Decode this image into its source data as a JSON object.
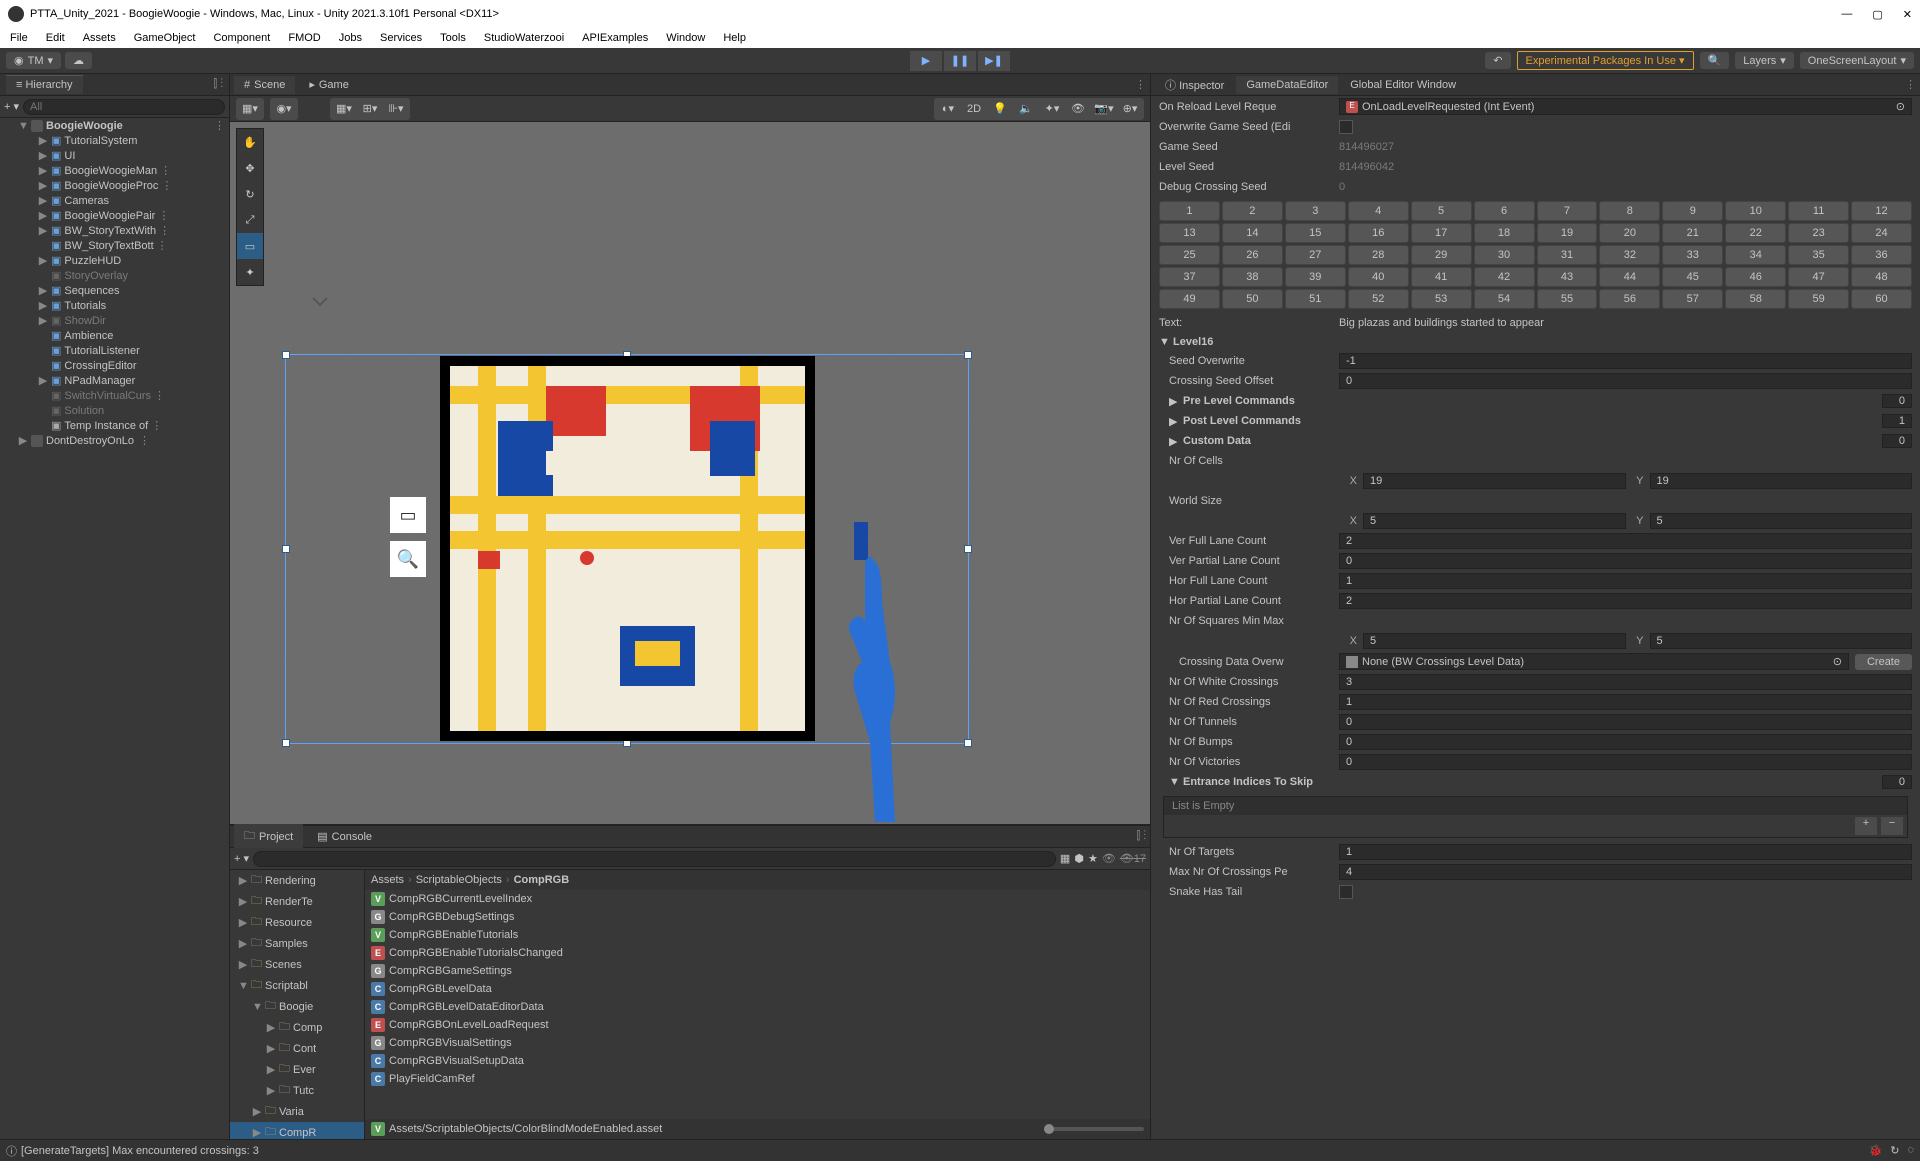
{
  "window": {
    "title": "PTTA_Unity_2021 - BoogieWoogie - Windows, Mac, Linux - Unity 2021.3.10f1 Personal <DX11>",
    "minimize": "—",
    "maximize": "▢",
    "close": "✕"
  },
  "menubar": [
    "File",
    "Edit",
    "Assets",
    "GameObject",
    "Component",
    "FMOD",
    "Jobs",
    "Services",
    "Tools",
    "StudioWaterzooi",
    "APIExamples",
    "Window",
    "Help"
  ],
  "toolbar": {
    "account": "TM",
    "experimental": "Experimental Packages In Use",
    "layers": "Layers",
    "layout": "OneScreenLayout"
  },
  "hierarchy": {
    "tab": "Hierarchy",
    "search_placeholder": "All",
    "scene": "BoogieWoogie",
    "items": [
      {
        "name": "TutorialSystem",
        "blue": true,
        "arrow": true
      },
      {
        "name": "UI",
        "blue": true,
        "arrow": true
      },
      {
        "name": "BoogieWoogieMan",
        "blue": true,
        "arrow": true,
        "trunc": true
      },
      {
        "name": "BoogieWoogieProc",
        "blue": true,
        "arrow": true,
        "trunc": true
      },
      {
        "name": "Cameras",
        "blue": true,
        "arrow": true
      },
      {
        "name": "BoogieWoogiePair",
        "blue": true,
        "arrow": true,
        "trunc": true
      },
      {
        "name": "BW_StoryTextWith",
        "blue": true,
        "arrow": true,
        "trunc": true
      },
      {
        "name": "BW_StoryTextBott",
        "blue": true,
        "trunc": true
      },
      {
        "name": "PuzzleHUD",
        "blue": true,
        "arrow": true
      },
      {
        "name": "StoryOverlay",
        "dim": true
      },
      {
        "name": "Sequences",
        "blue": true,
        "arrow": true
      },
      {
        "name": "Tutorials",
        "blue": true,
        "arrow": true
      },
      {
        "name": "ShowDir",
        "dim": true,
        "arrow": true
      },
      {
        "name": "Ambience",
        "blue": true
      },
      {
        "name": "TutorialListener",
        "blue": true
      },
      {
        "name": "CrossingEditor",
        "blue": true
      },
      {
        "name": "NPadManager",
        "blue": true,
        "arrow": true
      },
      {
        "name": "SwitchVirtualCurs",
        "dim": true,
        "trunc": true
      },
      {
        "name": "Solution",
        "dim": true
      },
      {
        "name": "Temp Instance of",
        "gray": true,
        "trunc": true
      }
    ],
    "dont_destroy": "DontDestroyOnLo"
  },
  "scene": {
    "tabs": [
      {
        "label": "Scene",
        "icon": "#"
      },
      {
        "label": "Game",
        "icon": "▶"
      }
    ],
    "btn_2d": "2D"
  },
  "project": {
    "tabs": [
      "Project",
      "Console"
    ],
    "hidden_count": "17",
    "folders": [
      {
        "name": "Rendering",
        "trunc": true
      },
      {
        "name": "RenderTe",
        "trunc": true
      },
      {
        "name": "Resource",
        "trunc": true
      },
      {
        "name": "Samples"
      },
      {
        "name": "Scenes"
      },
      {
        "name": "Scriptabl",
        "trunc": true,
        "open": true
      },
      {
        "name": "Boogie",
        "trunc": true,
        "indent": 1,
        "open": true
      },
      {
        "name": "Comp",
        "trunc": true,
        "indent": 2
      },
      {
        "name": "Cont",
        "trunc": true,
        "indent": 2
      },
      {
        "name": "Ever",
        "trunc": true,
        "indent": 2
      },
      {
        "name": "Tutc",
        "trunc": true,
        "indent": 2
      },
      {
        "name": "Varia",
        "trunc": true,
        "indent": 1
      },
      {
        "name": "CompR",
        "trunc": true,
        "indent": 1,
        "sel": true
      }
    ],
    "breadcrumb": [
      "Assets",
      "ScriptableObjects",
      "CompRGB"
    ],
    "assets": [
      {
        "badge": "V",
        "name": "CompRGBCurrentLevelIndex"
      },
      {
        "badge": "G",
        "name": "CompRGBDebugSettings"
      },
      {
        "badge": "V",
        "name": "CompRGBEnableTutorials"
      },
      {
        "badge": "E",
        "name": "CompRGBEnableTutorialsChanged"
      },
      {
        "badge": "G",
        "name": "CompRGBGameSettings"
      },
      {
        "badge": "C",
        "name": "CompRGBLevelData"
      },
      {
        "badge": "C",
        "name": "CompRGBLevelDataEditorData"
      },
      {
        "badge": "E",
        "name": "CompRGBOnLevelLoadRequest"
      },
      {
        "badge": "G",
        "name": "CompRGBVisualSettings"
      },
      {
        "badge": "C",
        "name": "CompRGBVisualSetupData"
      },
      {
        "badge": "C",
        "name": "PlayFieldCamRef"
      }
    ],
    "selected_path": "Assets/ScriptableObjects/ColorBlindModeEnabled.asset"
  },
  "statusbar": {
    "message": "[GenerateTargets] Max encountered crossings: 3"
  },
  "inspector": {
    "tabs": [
      "Inspector",
      "GameDataEditor",
      "Global Editor Window"
    ],
    "active_tab": 1,
    "on_reload_label": "On Reload Level Reque",
    "on_reload_value": "OnLoadLevelRequested (Int Event)",
    "overwrite_seed_label": "Overwrite Game Seed (Edi",
    "game_seed_label": "Game Seed",
    "game_seed": "814496027",
    "level_seed_label": "Level Seed",
    "level_seed": "814496042",
    "debug_crossing_label": "Debug Crossing Seed",
    "debug_crossing": "0",
    "numbers": [
      "1",
      "2",
      "3",
      "4",
      "5",
      "6",
      "7",
      "8",
      "9",
      "10",
      "11",
      "12",
      "13",
      "14",
      "15",
      "16",
      "17",
      "18",
      "19",
      "20",
      "21",
      "22",
      "23",
      "24",
      "25",
      "26",
      "27",
      "28",
      "29",
      "30",
      "31",
      "32",
      "33",
      "34",
      "35",
      "36",
      "37",
      "38",
      "39",
      "40",
      "41",
      "42",
      "43",
      "44",
      "45",
      "46",
      "47",
      "48",
      "49",
      "50",
      "51",
      "52",
      "53",
      "54",
      "55",
      "56",
      "57",
      "58",
      "59",
      "60"
    ],
    "text_label": "Text:",
    "text_value": "Big plazas and buildings started to appear",
    "level_header": "Level16",
    "seed_overwrite_label": "Seed Overwrite",
    "seed_overwrite": "-1",
    "crossing_offset_label": "Crossing Seed Offset",
    "crossing_offset": "0",
    "pre_level_label": "Pre Level Commands",
    "pre_level_count": "0",
    "post_level_label": "Post Level Commands",
    "post_level_count": "1",
    "custom_data_label": "Custom Data",
    "custom_data_count": "0",
    "nr_cells_label": "Nr Of Cells",
    "nr_cells_x": "19",
    "nr_cells_y": "19",
    "world_size_label": "World Size",
    "world_size_x": "5",
    "world_size_y": "5",
    "ver_full_label": "Ver Full Lane Count",
    "ver_full": "2",
    "ver_partial_label": "Ver Partial Lane Count",
    "ver_partial": "0",
    "hor_full_label": "Hor Full Lane Count",
    "hor_full": "1",
    "hor_partial_label": "Hor Partial Lane Count",
    "hor_partial": "2",
    "nr_sq_label": "Nr Of Squares Min Max",
    "nr_sq_x": "5",
    "nr_sq_y": "5",
    "crossing_data_label": "Crossing Data Overw",
    "crossing_data_value": "None (BW Crossings Level Data)",
    "create_btn": "Create",
    "white_cross_label": "Nr Of White Crossings",
    "white_cross": "3",
    "red_cross_label": "Nr Of Red Crossings",
    "red_cross": "1",
    "tunnels_label": "Nr Of Tunnels",
    "tunnels": "0",
    "bumps_label": "Nr Of Bumps",
    "bumps": "0",
    "victories_label": "Nr Of Victories",
    "victories": "0",
    "entrance_label": "Entrance Indices To Skip",
    "entrance_count": "0",
    "list_empty": "List is Empty",
    "targets_label": "Nr Of Targets",
    "targets": "1",
    "max_cross_label": "Max Nr Of Crossings Pe",
    "max_cross": "4",
    "snake_label": "Snake Has Tail"
  }
}
